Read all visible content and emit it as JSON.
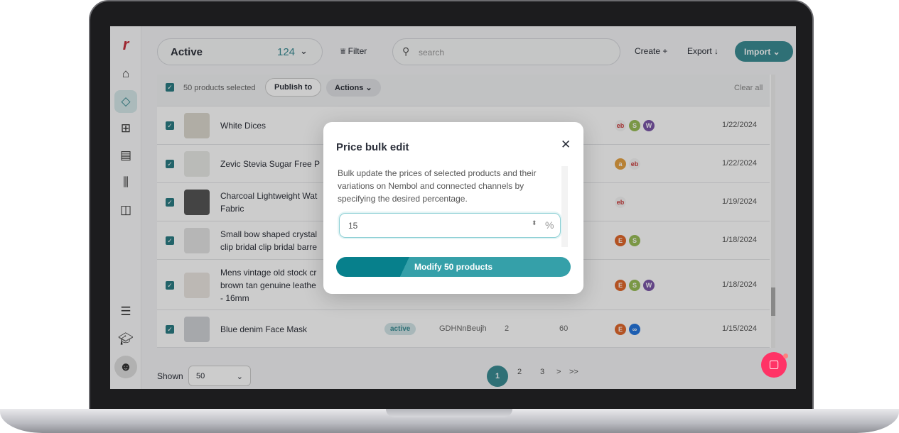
{
  "header": {
    "status_filter": "Active",
    "status_count": "124",
    "filter_label": "Filter",
    "search_placeholder": "search",
    "create_label": "Create",
    "export_label": "Export",
    "import_label": "Import"
  },
  "sidebar": {
    "items": [
      "home-icon",
      "tag-icon",
      "apps-add-icon",
      "document-icon",
      "bar-chart-icon",
      "layout-icon",
      "checklist-icon",
      "graduation-cap-icon",
      "avatar"
    ]
  },
  "selection_bar": {
    "count_label": "50 products selected",
    "publish_label": "Publish to",
    "actions_label": "Actions",
    "clear_label": "Clear all"
  },
  "rows": [
    {
      "name": "White Dices",
      "channels": [
        "ebay",
        "shopify",
        "woocommerce"
      ],
      "date": "1/22/2024"
    },
    {
      "name": "Zevic Stevia Sugar Free P",
      "channels": [
        "amazon",
        "ebay"
      ],
      "date": "1/22/2024"
    },
    {
      "name": "Charcoal Lightweight Wat\nFabric",
      "channels": [
        "ebay"
      ],
      "date": "1/19/2024"
    },
    {
      "name": "Small bow shaped crystal\nclip bridal clip bridal barre",
      "channels": [
        "etsy",
        "shopify"
      ],
      "date": "1/18/2024"
    },
    {
      "name": "Mens vintage old stock cr\nbrown tan genuine leathe\n- 16mm",
      "channels": [
        "etsy",
        "shopify",
        "woocommerce"
      ],
      "date": "1/18/2024"
    },
    {
      "name": "Blue denim Face Mask",
      "status": "active",
      "sku": "GDHNnBeujh",
      "variations": "2",
      "quantity": "60",
      "channels": [
        "etsy",
        "meta"
      ],
      "date": "1/15/2024"
    }
  ],
  "footer": {
    "shown_label": "Shown",
    "shown_value": "50",
    "pages": [
      "1",
      "2",
      "3"
    ],
    "current_page": "1",
    "next": ">",
    "last": ">>"
  },
  "modal": {
    "title": "Price bulk edit",
    "description": "Bulk update the prices of selected products and their variations on Nembol and connected channels by specifying the desired percentage.",
    "value": "15",
    "unit": "%",
    "submit_label": "Modify 50 products"
  },
  "colors": {
    "accent": "#2f8f98",
    "chat": "#ff3366",
    "logo": "#d92b3a"
  }
}
